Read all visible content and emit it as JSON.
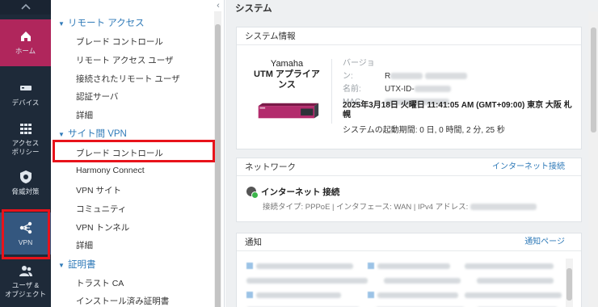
{
  "nav": {
    "up_arrow": "chevron-up-icon",
    "items": [
      {
        "label": "ホーム",
        "icon": "home-icon"
      },
      {
        "label": "デバイス",
        "icon": "device-icon"
      },
      {
        "label": "アクセス\nポリシー",
        "label_line1": "アクセス",
        "label_line2": "ポリシー",
        "icon": "grid-icon"
      },
      {
        "label": "脅威対策",
        "icon": "shield-icon"
      },
      {
        "label": "VPN",
        "icon": "vpn-icon"
      },
      {
        "label_line1": "ユーザ &",
        "label_line2": "オブジェクト",
        "icon": "users-icon"
      }
    ],
    "active_color": "#b0265c",
    "selected_color": "#34577f"
  },
  "menu": {
    "sections": [
      {
        "label": "リモート アクセス",
        "items": [
          "ブレード コントロール",
          "リモート アクセス ユーザ",
          "接続されたリモート ユーザ",
          "認証サーバ",
          "詳細"
        ]
      },
      {
        "label": "サイト間 VPN",
        "items": [
          "ブレード コントロール",
          "Harmony Connect",
          "VPN サイト",
          "コミュニティ",
          "VPN トンネル",
          "詳細"
        ]
      },
      {
        "label": "証明書",
        "items": [
          "トラスト CA",
          "インストール済み証明書"
        ]
      }
    ]
  },
  "main": {
    "title": "システム",
    "system_card": {
      "title": "システム情報",
      "model_line1": "Yamaha",
      "model_line2": "UTM アプライア",
      "model_line3": "ンス",
      "version_label": "バージョン:",
      "version_value": "R",
      "name_label": "名前:",
      "name_value": "UTX-ID-",
      "mac_label": "MAC:",
      "date_line1": "2025年3月18日 火曜日 11:41:05 AM (GMT+09:00) 東京 大阪 札",
      "date_line2": "幌",
      "uptime": "システムの起動期間: 0 日, 0 時間, 2 分, 25 秒"
    },
    "network_card": {
      "title": "ネットワーク",
      "link": "インターネット接続",
      "status": "インターネット 接続",
      "detail": "接続タイプ: PPPoE | インタフェース: WAN | IPv4 アドレス:"
    },
    "notify_card": {
      "title": "通知",
      "link": "通知ページ"
    }
  },
  "colors": {
    "link": "#2f7ab8",
    "highlight": "#e8131b"
  }
}
